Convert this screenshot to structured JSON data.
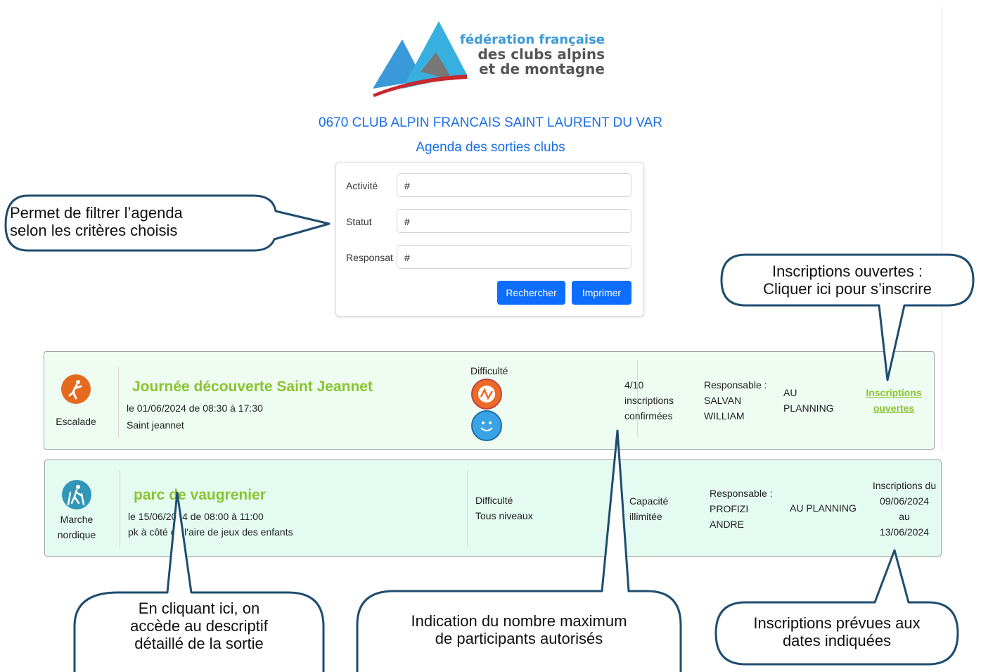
{
  "logo": {
    "line1": "fédération française",
    "line2": "des clubs alpins",
    "line3": "et de montagne"
  },
  "header": {
    "club": "0670 CLUB ALPIN FRANCAIS SAINT LAURENT DU VAR",
    "agenda": "Agenda des sorties clubs"
  },
  "filters": {
    "activite_label": "Activité",
    "activite_value": "#",
    "statut_label": "Statut",
    "statut_value": "#",
    "responsable_label": "Responsat",
    "responsable_value": "#",
    "search_button": "Rechercher",
    "print_button": "Imprimer"
  },
  "outings": [
    {
      "activity": "Escalade",
      "title": "Journée découverte Saint Jeannet",
      "date": "le 01/06/2024 de 08:30 à 17:30",
      "place": "Saint jeannet",
      "difficulty_label": "Difficulté",
      "capacity_1": "4/10",
      "capacity_2": "inscriptions",
      "capacity_3": "confirmées",
      "resp_label": "Responsable :",
      "resp_1": "SALVAN",
      "resp_2": "WILLIAM",
      "status_1": "AU",
      "status_2": "PLANNING",
      "inscr_1": "Inscriptions",
      "inscr_2": "ouvertes",
      "color": "#e56a1e"
    },
    {
      "activity_1": "Marche",
      "activity_2": "nordique",
      "title": "parc de vaugrenier",
      "date": "le 15/06/2024 de 08:00 à 11:00",
      "place": "pk à côté de l'aire de jeux des enfants",
      "difficulty_label": "Difficulté",
      "difficulty_value": "Tous niveaux",
      "capacity_1": "Capacité",
      "capacity_2": "illimitée",
      "resp_label": "Responsable :",
      "resp_1": "PROFIZI",
      "resp_2": "ANDRE",
      "status": "AU PLANNING",
      "inscr_1": "Inscriptions du",
      "inscr_2": "09/06/2024",
      "inscr_3": "au",
      "inscr_4": "13/06/2024",
      "color": "#3296b8"
    }
  ],
  "callouts": {
    "filter_1": "Permet de filtrer l’agenda",
    "filter_2": "selon les critères choisis",
    "open_1": "Inscriptions ouvertes :",
    "open_2": "Cliquer ici pour s’inscrire",
    "detail_1": "En cliquant ici, on",
    "detail_2": "accède au descriptif",
    "detail_3": "détaillé de la sortie",
    "max_1": "Indication du nombre maximum",
    "max_2": "de participants autorisés",
    "dates_1": "Inscriptions prévues aux",
    "dates_2": "dates indiquées"
  },
  "colors": {
    "accent": "#1a6fe8",
    "button": "#0d6efd",
    "title_green": "#8ac42f",
    "callout_border": "#1f4d6f"
  }
}
